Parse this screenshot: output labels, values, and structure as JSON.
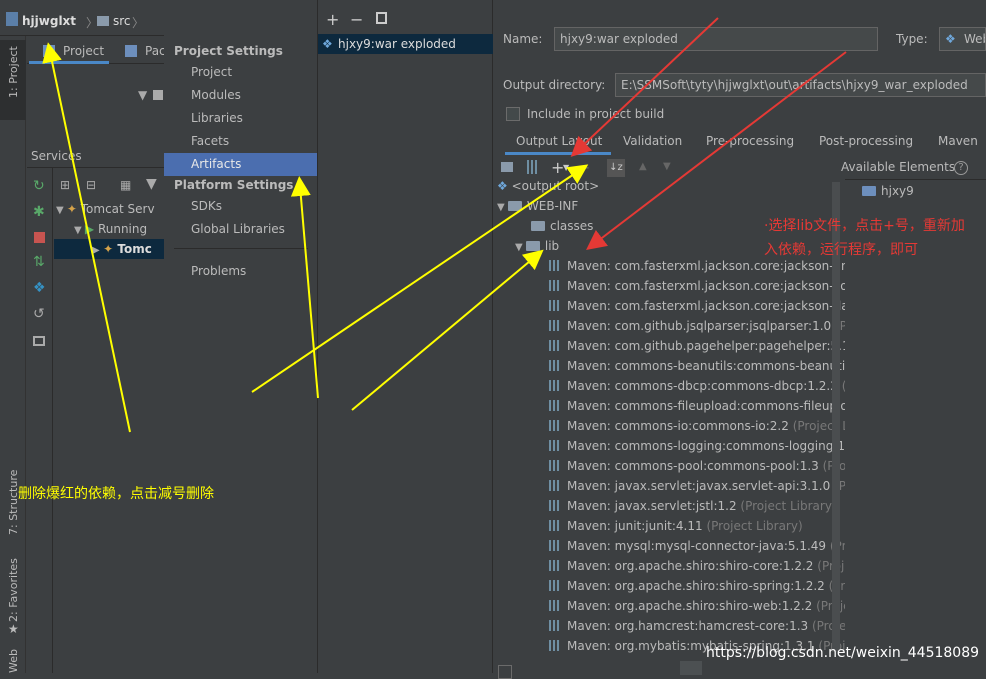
{
  "navbar": {
    "crumbs": [
      "hjjwglxt",
      "src"
    ]
  },
  "left_strip": {
    "labels": [
      "1: Project",
      "7: Structure",
      "2: Favorites",
      "Web"
    ]
  },
  "project_tabs": [
    "Project",
    "Pac"
  ],
  "services": {
    "title": "Services",
    "tree": [
      "Tomcat Serv",
      "Running",
      "Tomc"
    ]
  },
  "project_structure": {
    "project_settings_header": "Project Settings",
    "project_settings_items": [
      "Project",
      "Modules",
      "Libraries",
      "Facets",
      "Artifacts"
    ],
    "selected_item": "Artifacts",
    "platform_settings_header": "Platform Settings",
    "platform_settings_items": [
      "SDKs",
      "Global Libraries"
    ],
    "problems": "Problems"
  },
  "artifacts": {
    "toolbar": [
      "+",
      "−",
      "copy"
    ],
    "items": [
      "hjxy9:war exploded"
    ]
  },
  "artifact_form": {
    "name_label": "Name:",
    "name_value": "hjxy9:war exploded",
    "type_label": "Type:",
    "type_value": "Web",
    "output_dir_label": "Output directory:",
    "output_dir_value": "E:\\SSMSoft\\tyty\\hjjwglxt\\out\\artifacts\\hjxy9_war_exploded",
    "include_label": "Include in project build",
    "tabs": [
      "Output Layout",
      "Validation",
      "Pre-processing",
      "Post-processing",
      "Maven"
    ],
    "active_tab": "Output Layout",
    "available_elements": "Available Elements",
    "available_root": "hjxy9"
  },
  "output_tree": {
    "root": "<output root>",
    "web_inf": "WEB-INF",
    "classes": "classes",
    "lib": "lib",
    "libs": [
      {
        "name": "Maven: com.fasterxml.jackson.core:jackson-ann",
        "suffix": ""
      },
      {
        "name": "Maven: com.fasterxml.jackson.core:jackson-cor",
        "suffix": ""
      },
      {
        "name": "Maven: com.fasterxml.jackson.core:jackson-dat",
        "suffix": ""
      },
      {
        "name": "Maven: com.github.jsqlparser:jsqlparser:1.0",
        "suffix": " (Pr"
      },
      {
        "name": "Maven: com.github.pagehelper:pagehelper:5.1",
        "suffix": ""
      },
      {
        "name": "Maven: commons-beanutils:commons-beanutil",
        "suffix": ""
      },
      {
        "name": "Maven: commons-dbcp:commons-dbcp:1.2.2",
        "suffix": " ("
      },
      {
        "name": "Maven: commons-fileupload:commons-fileuplo",
        "suffix": ""
      },
      {
        "name": "Maven: commons-io:commons-io:2.2",
        "suffix": " (Project L"
      },
      {
        "name": "Maven: commons-logging:commons-logging:1",
        "suffix": ""
      },
      {
        "name": "Maven: commons-pool:commons-pool:1.3",
        "suffix": " (Pro"
      },
      {
        "name": "Maven: javax.servlet:javax.servlet-api:3.1.0",
        "suffix": " (Proj"
      },
      {
        "name": "Maven: javax.servlet:jstl:1.2",
        "suffix": " (Project Library)"
      },
      {
        "name": "Maven: junit:junit:4.11",
        "suffix": " (Project Library)"
      },
      {
        "name": "Maven: mysql:mysql-connector-java:5.1.49",
        "suffix": " (Pro"
      },
      {
        "name": "Maven: org.apache.shiro:shiro-core:1.2.2",
        "suffix": " (Proj"
      },
      {
        "name": "Maven: org.apache.shiro:shiro-spring:1.2.2",
        "suffix": " (Pro"
      },
      {
        "name": "Maven: org.apache.shiro:shiro-web:1.2.2",
        "suffix": " (Proje"
      },
      {
        "name": "Maven: org.hamcrest:hamcrest-core:1.3",
        "suffix": " (Projec"
      },
      {
        "name": "Maven: org.mybatis:mybatis-spring:1.3.1",
        "suffix": " (Proje"
      }
    ]
  },
  "annotations": {
    "red_note": "·选择lib文件，点击+号，重新加入依赖，运行程序，即可",
    "yellow_note": "删除爆红的依赖，点击减号删除",
    "watermark": "https://blog.csdn.net/weixin_44518089"
  },
  "colors": {
    "selection": "#4b6eaf",
    "red": "#e53935",
    "yellow": "#ffff00"
  }
}
